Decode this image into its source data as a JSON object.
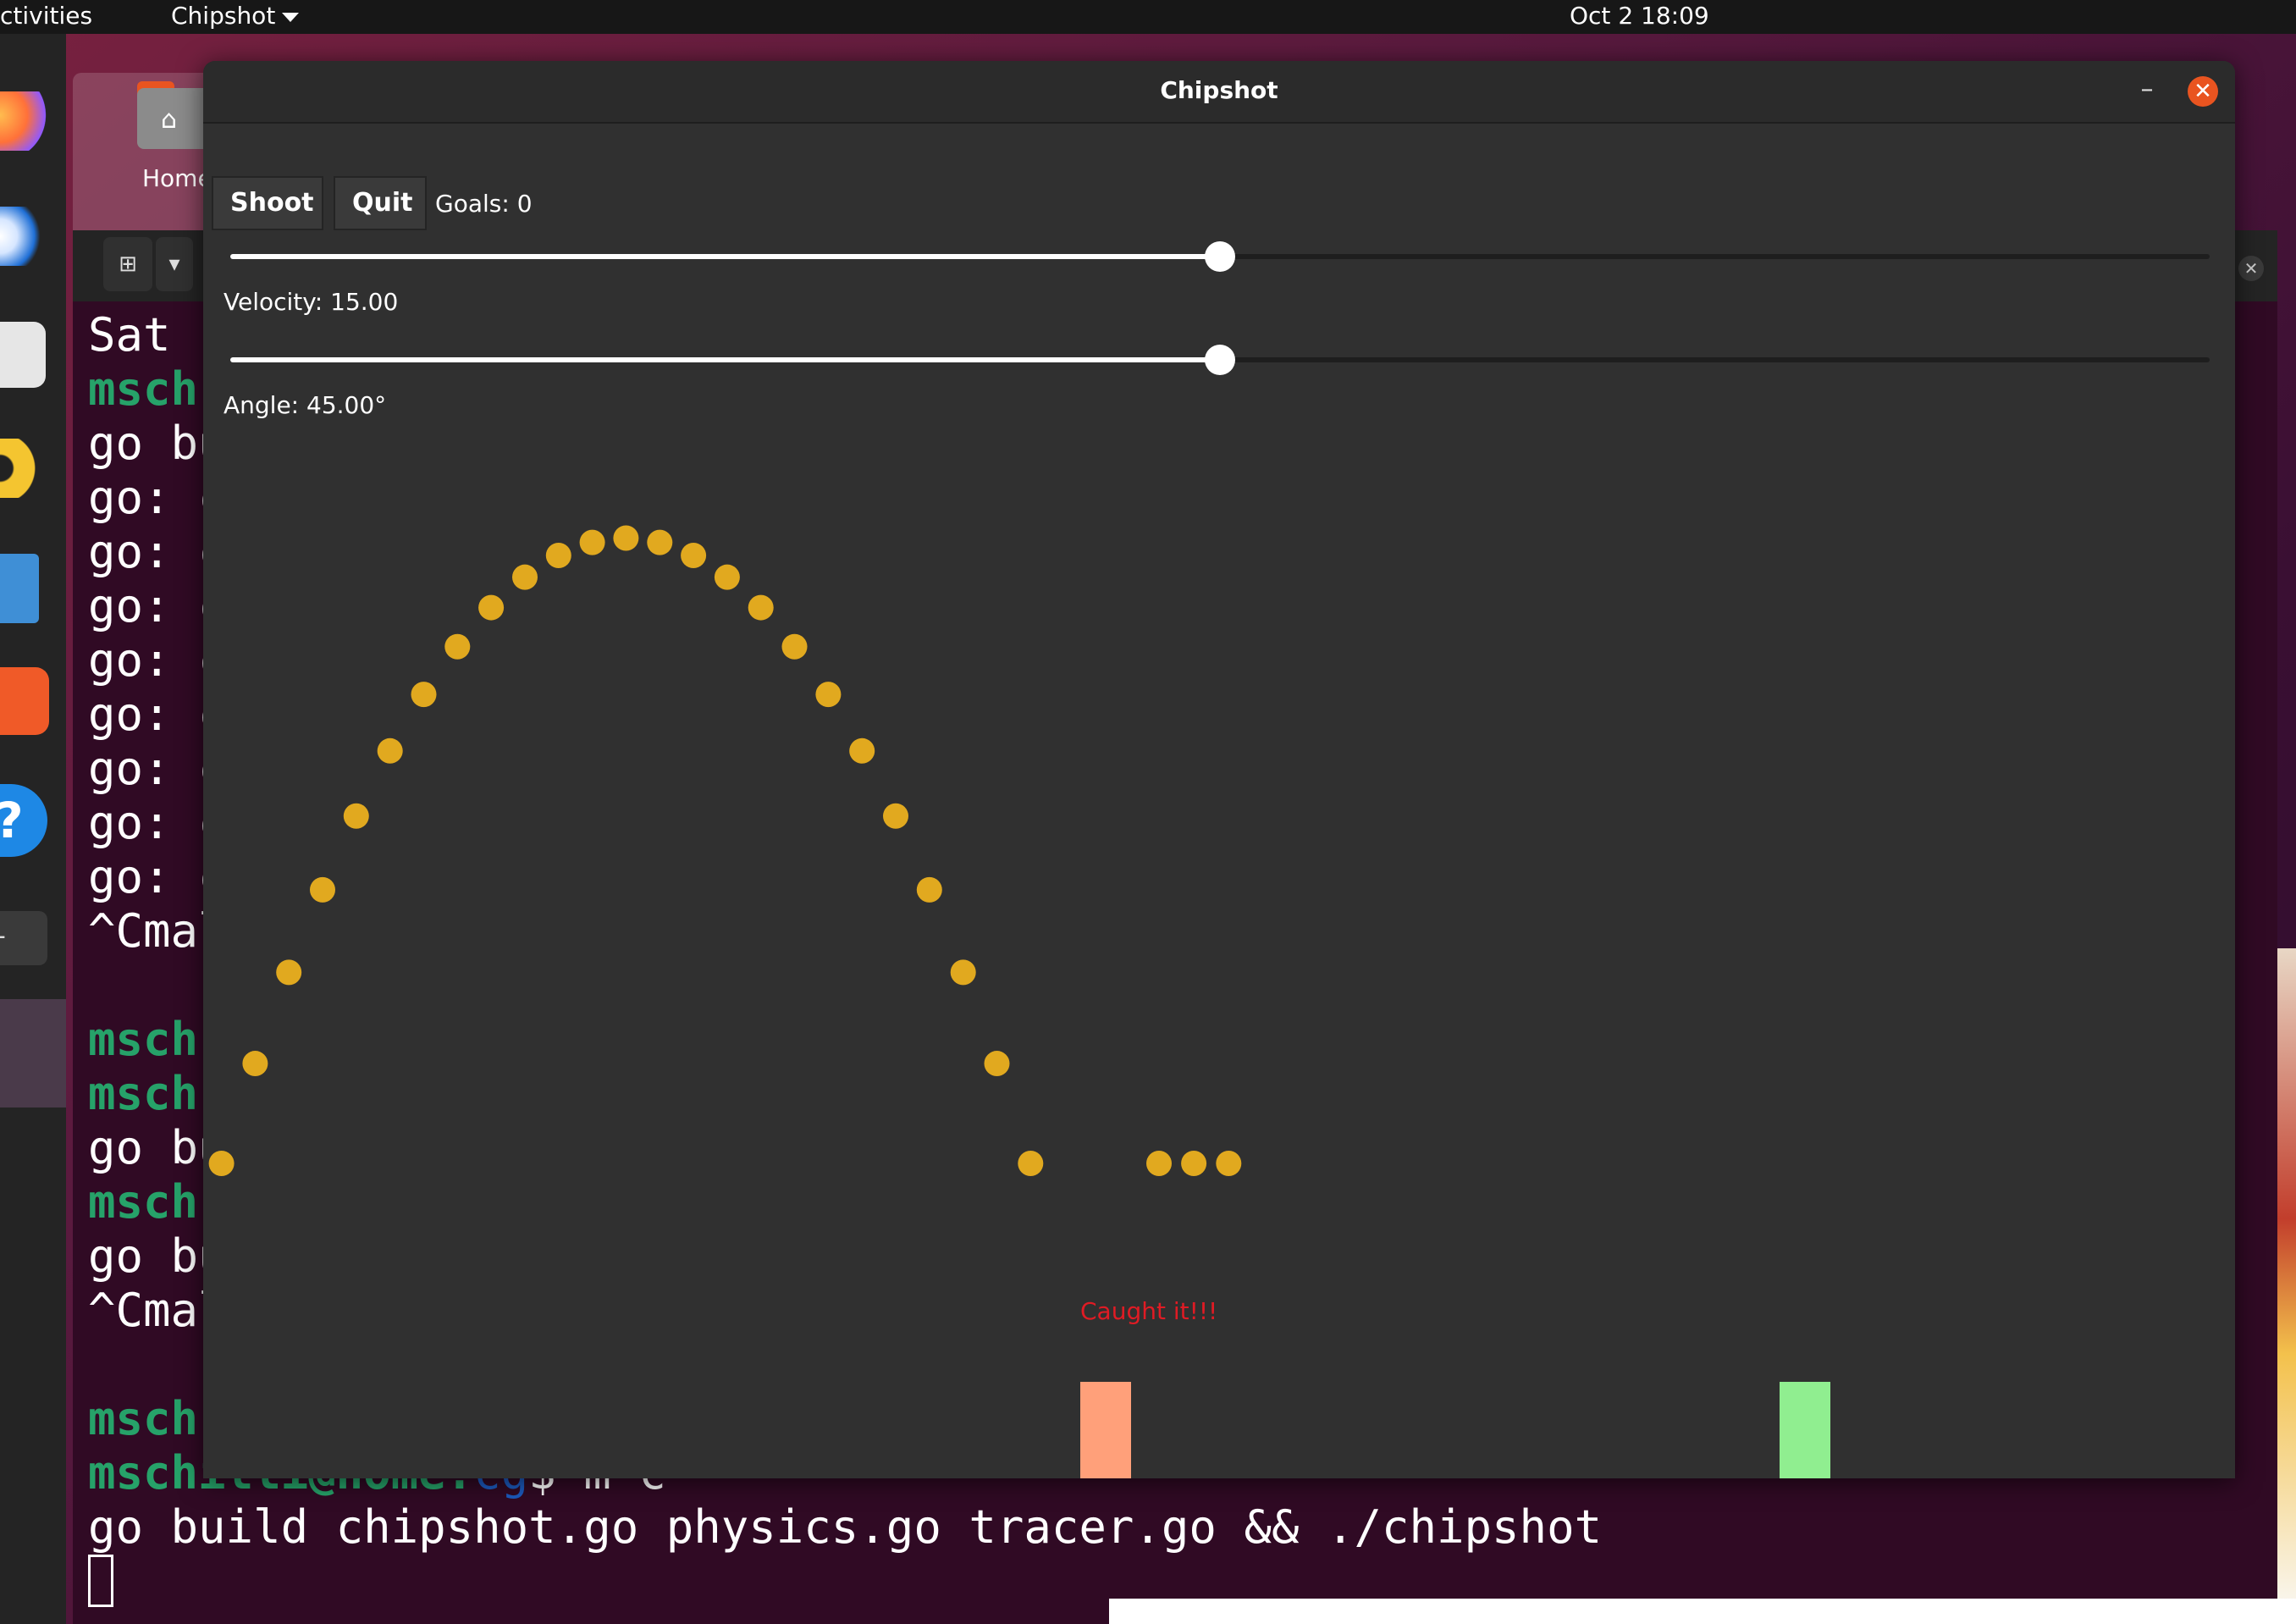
{
  "topbar": {
    "activities": "ctivities",
    "app_menu": "Chipshot",
    "clock": "Oct 2  18:09"
  },
  "desktop": {
    "home_label": "Home"
  },
  "dock": {
    "items": [
      "firefox-icon",
      "thunderbird-icon",
      "files-icon",
      "rhythmbox-icon",
      "writer-icon",
      "app-center-icon",
      "help-icon",
      "terminal-icon",
      "active-window-icon"
    ],
    "help_glyph": "?",
    "terminal_glyph": "-"
  },
  "terminal": {
    "lines": [
      {
        "text": "Sat (",
        "style": "plain"
      },
      {
        "text": "msch:",
        "style": "prompt"
      },
      {
        "text": "go bu",
        "style": "plain"
      },
      {
        "text": "go: c",
        "style": "plain"
      },
      {
        "text": "go: c",
        "style": "plain"
      },
      {
        "text": "go: c",
        "style": "plain"
      },
      {
        "text": "go: c",
        "style": "plain"
      },
      {
        "text": "go: c",
        "style": "plain"
      },
      {
        "text": "go: c",
        "style": "plain"
      },
      {
        "text": "go: c",
        "style": "plain"
      },
      {
        "text": "go: c",
        "style": "plain"
      },
      {
        "text": "^Cmal",
        "style": "plain"
      },
      {
        "text": "",
        "style": "plain"
      },
      {
        "text": "msch:",
        "style": "prompt"
      },
      {
        "text": "msch:",
        "style": "prompt"
      },
      {
        "text": "go bu",
        "style": "plain"
      },
      {
        "text": "msch:",
        "style": "prompt"
      },
      {
        "text": "go bu",
        "style": "plain"
      },
      {
        "text": "^Cmal",
        "style": "plain"
      },
      {
        "text": "",
        "style": "plain"
      },
      {
        "text": "msch:",
        "style": "prompt"
      },
      {
        "text": "mschilli@home:cg$ m c",
        "style": "prompt-full"
      },
      {
        "text": "go build chipshot.go physics.go tracer.go && ./chipshot",
        "style": "plain"
      }
    ],
    "prompt_user": "mschilli@home",
    "prompt_dir": "cg",
    "prompt_cmd": "$ m c"
  },
  "window": {
    "title": "Chipshot",
    "minimize_glyph": "–",
    "close_glyph": "✕",
    "shoot_label": "Shoot",
    "quit_label": "Quit",
    "goals_text": "Goals: 0",
    "velocity": {
      "label": "Velocity: 15.00",
      "value": 15.0,
      "fraction": 0.5
    },
    "angle": {
      "label": "Angle: 45.00°",
      "value": 45.0,
      "fraction": 0.5
    },
    "caught_text": "Caught it!!!"
  },
  "colors": {
    "ball": "#e1a91f",
    "catcher": "#ffa07a",
    "goal": "#90ee90",
    "caught_text": "#e01b24",
    "window_bg": "#303030"
  }
}
